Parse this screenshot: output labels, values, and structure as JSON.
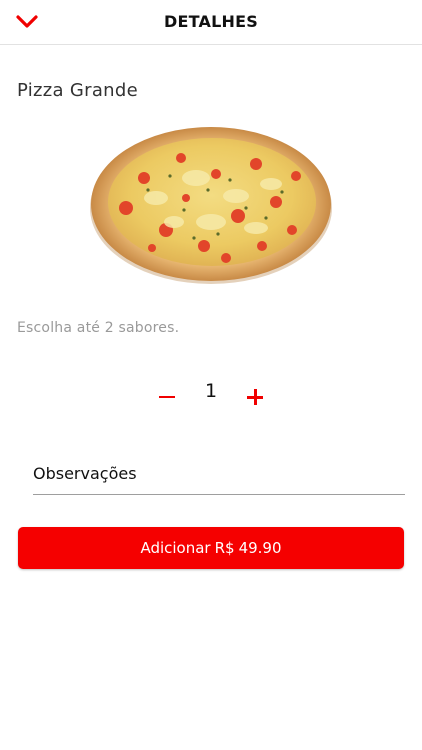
{
  "header": {
    "title": "DETALHES",
    "back_icon": "chevron-down-icon",
    "accent_color": "#f00000"
  },
  "product": {
    "name": "Pizza Grande",
    "image": "pizza-image",
    "hint": "Escolha até 2 sabores."
  },
  "quantity": {
    "value": "1",
    "minus_icon": "minus-icon",
    "plus_icon": "plus-icon"
  },
  "notes": {
    "placeholder": "Observações"
  },
  "cta": {
    "label": "Adicionar",
    "currency": "R$",
    "price": "49.90",
    "color": "#f50000"
  }
}
